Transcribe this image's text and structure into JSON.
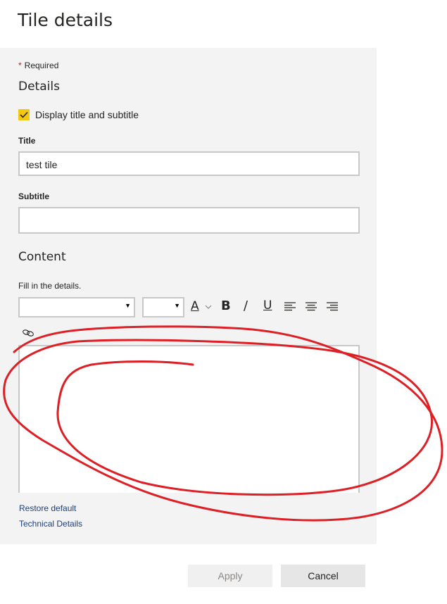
{
  "page": {
    "title": "Tile details"
  },
  "form": {
    "required_note": "Required",
    "details_heading": "Details",
    "display_checkbox": {
      "label": "Display title and subtitle",
      "checked": true,
      "color": "#f2c811"
    },
    "title_label": "Title",
    "title_value": "test tile",
    "subtitle_label": "Subtitle",
    "subtitle_value": "",
    "content_heading": "Content",
    "content_hint": "Fill in the details.",
    "font_family_value": "",
    "font_size_value": "",
    "toolbar": {
      "font_color_glyph": "A",
      "bold_glyph": "B",
      "italic_glyph": "/",
      "underline_glyph": "U",
      "icons": [
        "font-color-icon",
        "bold-icon",
        "italic-icon",
        "underline-icon",
        "align-left-icon",
        "align-center-icon",
        "align-right-icon",
        "link-icon"
      ]
    },
    "content_value": ""
  },
  "links": {
    "restore_default": "Restore default",
    "technical_details": "Technical Details"
  },
  "buttons": {
    "apply": "Apply",
    "cancel": "Cancel"
  },
  "colors": {
    "panel_bg": "#f3f3f3",
    "accent": "#f2c811",
    "link": "#1e3f76",
    "annotation": "#dd1f26"
  }
}
